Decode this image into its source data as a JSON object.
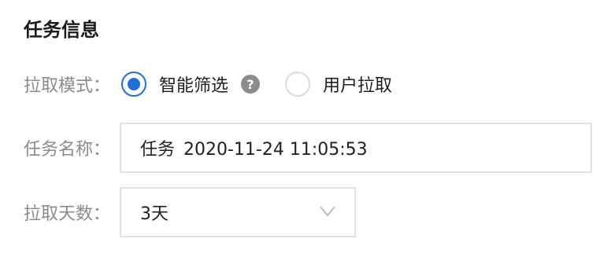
{
  "section": {
    "title": "任务信息"
  },
  "fields": {
    "mode": {
      "label": "拉取模式：",
      "options": [
        "智能筛选",
        "用户拉取"
      ],
      "selected": "智能筛选",
      "help_icon": "question-circle-icon"
    },
    "task_name": {
      "label": "任务名称：",
      "value": "任务_2020-11-24 11:05:53"
    },
    "days": {
      "label": "拉取天数：",
      "value": "3天",
      "icon": "chevron-down-icon"
    }
  },
  "colors": {
    "accent": "#1f6fd6",
    "label": "#8a8a8a",
    "border": "#e1e1e1"
  }
}
